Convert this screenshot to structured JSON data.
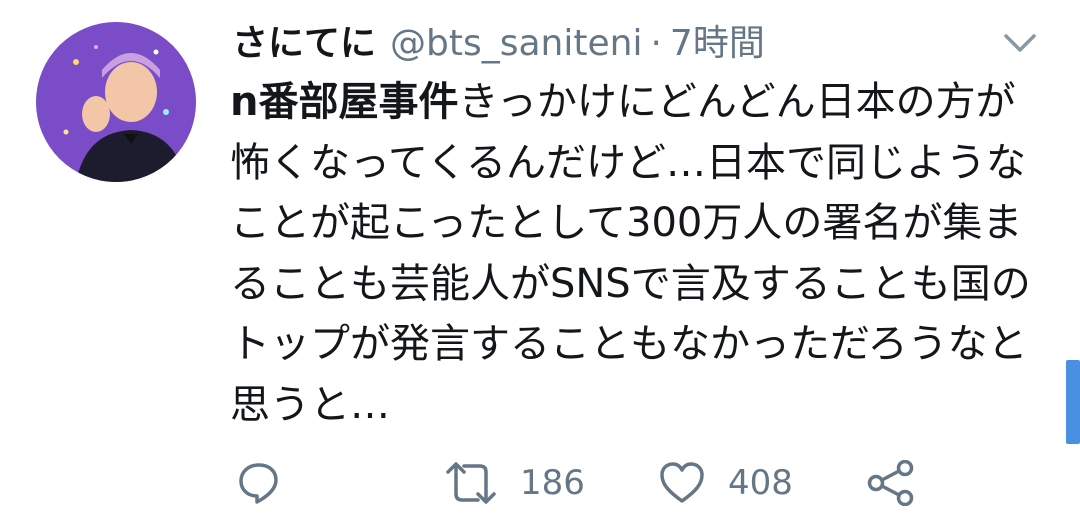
{
  "tweet": {
    "display_name": "さにてに",
    "handle": "@bts_saniteni",
    "separator": "·",
    "time": "7時間",
    "text_highlight": "n番部屋事件",
    "text_body": "きっかけにどんどん日本の方が怖くなってくるんだけど…日本で同じようなことが起こったとして300万人の署名が集まることも芸能人がSNSで言及することも国のトップが発言することもなかっただろうなと思うと…",
    "retweet_count": "186",
    "like_count": "408"
  },
  "icons": {
    "avatar": "avatar-image",
    "chevron": "chevron-down-icon",
    "reply": "reply-icon",
    "retweet": "retweet-icon",
    "like": "heart-icon",
    "share": "share-icon"
  },
  "colors": {
    "text": "#14171a",
    "muted": "#657786",
    "scrollbar": "#4a90e2"
  }
}
